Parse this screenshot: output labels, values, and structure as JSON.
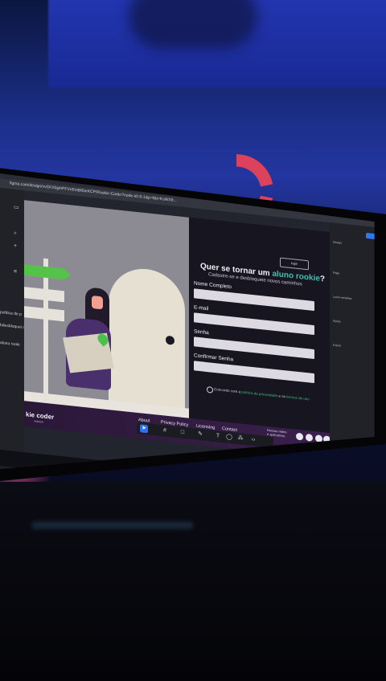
{
  "browser": {
    "tab_left": "...HTML",
    "tab_figma": "Rookie Coder – Figma",
    "tab_cadastro": "Cadastro | Rookie Coder",
    "url": "figma.com/design/vvCKXbjyhPFVnEmB65eKCP/Rookie-Coder?node-id=0-1&p=f&t=KsWX9..."
  },
  "left_panel": {
    "item1": "política de p",
    "item2": "bdesbloquei n",
    "item3": "aluno rooki"
  },
  "form": {
    "login_label": "login",
    "title_prefix": "Quer se tornar um ",
    "title_highlight": "aluno rookie",
    "title_suffix": "?",
    "subtitle": "Cadastre-se e desbloqueie novos caminhos",
    "field_name_label": "Nome Completo",
    "field_email_label": "E-mail",
    "field_password_label": "Senha",
    "field_confirm_label": "Confirmar Senha",
    "agree_prefix": "Concordo com a ",
    "agree_privacy": "política de privacidade",
    "agree_mid": " e os ",
    "agree_terms": "termos de uso"
  },
  "footer": {
    "brand": "kie coder",
    "brand_sub": "network",
    "links": [
      "About",
      "Privacy Policy",
      "Licensing",
      "Contact"
    ],
    "note_line1": "Nossas redes",
    "note_line2": "e aplicativos."
  },
  "taskbar": {
    "label": "log"
  },
  "colors": {
    "accent_green": "#55c24a",
    "highlight_teal": "#38c4b0",
    "footer_purple": "#3a1f4c",
    "figma_blue": "#2f78ee"
  }
}
